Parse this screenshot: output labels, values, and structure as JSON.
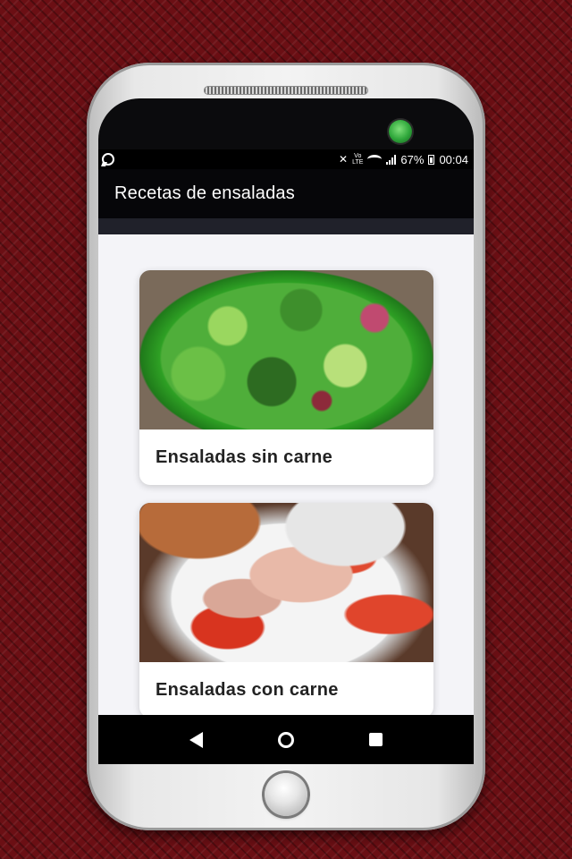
{
  "status_bar": {
    "battery_percent": "67%",
    "time": "00:04",
    "network_label": "LTE",
    "icons": [
      "whatsapp-icon",
      "mute-icon",
      "lte-icon",
      "wifi-icon",
      "signal-icon",
      "battery-icon"
    ]
  },
  "app_bar": {
    "title": "Recetas de ensaladas"
  },
  "cards": [
    {
      "title": "Ensaladas sin carne",
      "image": "green-salad-photo"
    },
    {
      "title": "Ensaladas con carne",
      "image": "tuna-tomato-salad-photo"
    }
  ],
  "nav_bar": {
    "icons": [
      "back-icon",
      "home-icon",
      "recent-apps-icon"
    ]
  },
  "colors": {
    "background": "#6b0f14",
    "app_bar": "#060609",
    "screen": "#f4f4f8",
    "accent_camera": "#2ea63a"
  }
}
